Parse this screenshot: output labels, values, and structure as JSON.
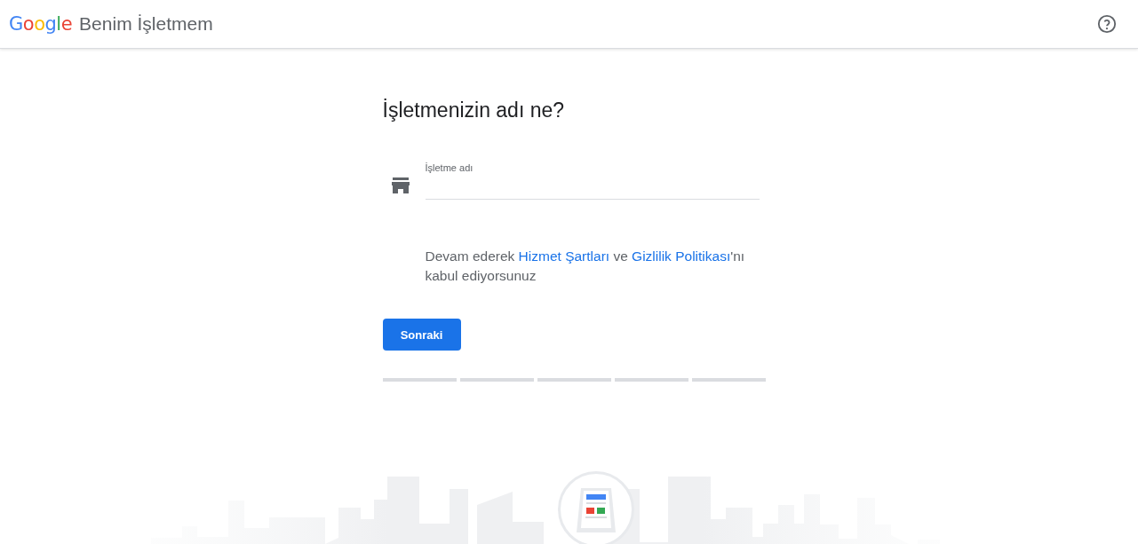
{
  "header": {
    "logo": "Google",
    "product": "Benim İşletmem"
  },
  "form": {
    "heading": "İşletmenizin adı ne?",
    "field": {
      "label": "İşletme adı"
    },
    "consent": {
      "before": "Devam ederek ",
      "link_1": "Hizmet Şartları",
      "middle": " ve ",
      "link_2": "Gizlilik Politikası",
      "after": "'nı kabul ediyorsunuz"
    },
    "button": "Sonraki",
    "steps": [
      {
        "done": false
      },
      {
        "done": false
      },
      {
        "done": false
      },
      {
        "done": false
      },
      {
        "done": false
      }
    ]
  }
}
